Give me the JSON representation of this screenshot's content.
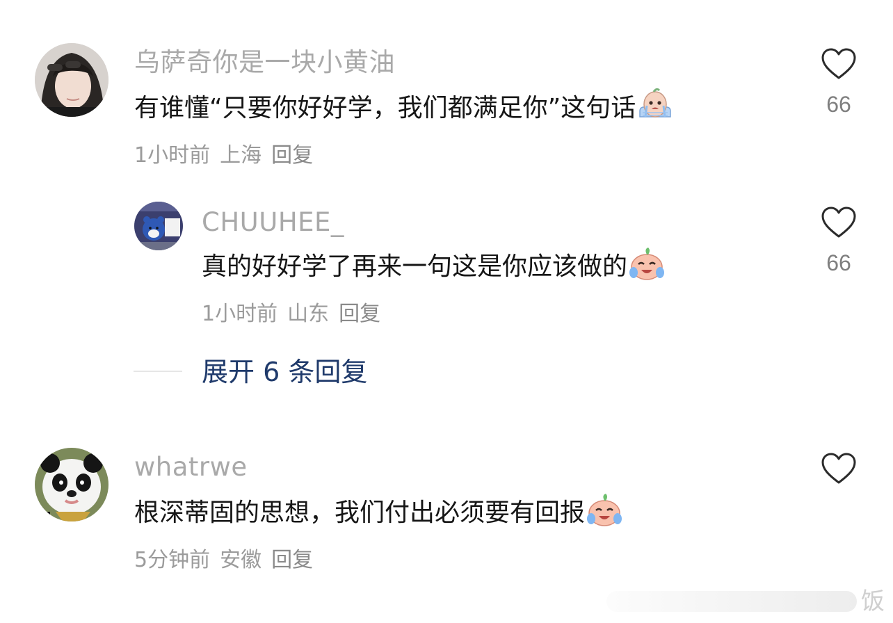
{
  "comments": [
    {
      "username": "乌萨奇你是一块小黄油",
      "text": "有谁懂“只要你好好学，我们都满足你”这句话",
      "emoji": "crying-face-emoji",
      "time": "1小时前",
      "location": "上海",
      "reply_label": "回复",
      "likes": "66"
    },
    {
      "username": "CHUUHEE_",
      "text": "真的好好学了再来一句这是你应该做的",
      "emoji": "laugh-cry-emoji",
      "time": "1小时前",
      "location": "山东",
      "reply_label": "回复",
      "likes": "66"
    },
    {
      "username": "whatrwe",
      "text": "根深蒂固的思想，我们付出必须要有回报",
      "emoji": "laugh-cry-emoji",
      "time": "5分钟前",
      "location": "安徽",
      "reply_label": "回复",
      "likes": ""
    }
  ],
  "expand_replies": "展开 6 条回复",
  "watermark": "饭",
  "colors": {
    "username": "#a9a9a9",
    "text": "#161616",
    "meta": "#9b9b9b",
    "expand": "#1f3a6b",
    "heart": "#2b2b2b"
  }
}
